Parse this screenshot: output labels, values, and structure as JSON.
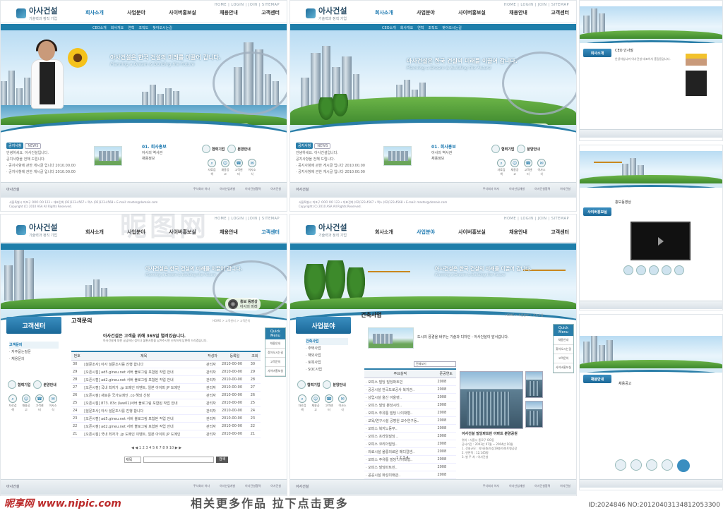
{
  "brand": {
    "name": "아사건설",
    "tagline": "기술력과 정직 기업"
  },
  "util_links": "HOME | LOGIN | JOIN | SITEMAP",
  "menu": [
    "회사소개",
    "사업분야",
    "사이버홍보실",
    "채용안내",
    "고객센터"
  ],
  "sublinks": [
    "CEO소개",
    "회사개요",
    "연혁",
    "조직도",
    "찾아오시는길"
  ],
  "slogan": "아사건설은 한국 건설의 미래를 이끌어 갑니다.",
  "slogan_en": "Planning a Dream & Building the Future",
  "promo": {
    "title": "홍보 동영상",
    "sub": "아사의 미래"
  },
  "news": {
    "tag": "공지사항",
    "tag2": "NEWS",
    "items": [
      "안녕하세요. 아사건설입니다.",
      "공지사항을 전해 드립니다.",
      "· 공지사항에 관한 게시글 입니다 2010.00.00",
      "· 공지사항에 관한 게시글 입니다 2010.00.00"
    ]
  },
  "pr": {
    "title": "01. 회사홍보",
    "line1": "아사의 역사관",
    "line2": "채용정보"
  },
  "circ": [
    "협력기업",
    "분양안내"
  ],
  "icons": [
    "자료검색",
    "채용공고",
    "고객센터",
    "이사소식"
  ],
  "footer_links": [
    "아사건설",
    "주식회사 아사",
    "아사산업개발",
    "아사건설협력",
    "아사건설"
  ],
  "address": "서울특별시 마포구 OOO OO 123 • 대표전화 (02)123-4567 • 팩스 (02)123-4568 • E-mail: master@domain.com",
  "copyright": "Copyright (C) 2010 ASA All Rights Reserved.",
  "customer": {
    "side_title": "고객센터",
    "side_menu": [
      "고객문의",
      "· 자주묻는질문",
      "· 채용문의"
    ],
    "page_title": "고객문의",
    "crumb": "HOME > 고객센터 > 고객문의",
    "intro": "아사건설은 고객을 위해 365일 열려있습니다.",
    "intro2": "아사건설에 대한 궁금하신 점이나 불편사항을 남겨주시면 신속하게 답변해 드리겠습니다.",
    "cols": [
      "번호",
      "제목",
      "작성자",
      "등록일",
      "조회"
    ],
    "rows": [
      [
        "30",
        "[설문조사] 아사 설문조사를 진행 합니다",
        "관리자",
        "2010-00-00",
        "30"
      ],
      [
        "29",
        "[오픈시점] ad5.gineu.net 서버 블로그링 포함된 작업 안내",
        "관리자",
        "2010-00-00",
        "29"
      ],
      [
        "28",
        "[오픈시점] ad2.gineu.net 서버 블로그링 포함된 작업 안내",
        "관리자",
        "2010-00-00",
        "28"
      ],
      [
        "27",
        "[오픈시점] 국내 최저가 .jp 도메인 이벤트, 일본 아이피 JP 도메인",
        "관리자",
        "2010-00-00",
        "27"
      ],
      [
        "26",
        "[오픈시점] 새로운 국가도메인 .co 해외 신청",
        "관리자",
        "2010-00-00",
        "26"
      ],
      [
        "25",
        "[오픈시점] 873. 83c.(law01)서버 블로그링 포함된 작업 안내",
        "관리자",
        "2010-00-00",
        "25"
      ],
      [
        "24",
        "[설문조사] 아사 설문조사를 진행 합니다",
        "관리자",
        "2010-00-00",
        "24"
      ],
      [
        "23",
        "[오픈시점] ad5.gineu.net 서버 블로그링 포함된 작업 안내",
        "관리자",
        "2010-00-00",
        "23"
      ],
      [
        "22",
        "[오픈시점] ad2.gineu.net 서버 블로그링 포함된 작업 안내",
        "관리자",
        "2010-00-00",
        "22"
      ],
      [
        "21",
        "[오픈시점] 국내 최저가 .jp 도메인 이벤트, 일본 아이피 JP 도메인",
        "관리자",
        "2010-00-00",
        "21"
      ]
    ],
    "pager": "◀ ◀  1 2 3 4 5 6 7 8 9 10  ▶ ▶",
    "search_sel": "제목",
    "search_btn": "검색"
  },
  "business": {
    "side_title": "사업분야",
    "side_menu": [
      "건축사업",
      "· 주택사업",
      "· 해외사업",
      "· 토목사업",
      "· SOC사업"
    ],
    "page_title": "건축사업",
    "crumb": "HOME > 사업분야 > 건축사업",
    "intro": "도시의 풍경을 바꾸는 기술과 디자인 - 아사건설이 앞서갑니다.",
    "cols": [
      "주요실적",
      "준공연도"
    ],
    "select": "전체보기",
    "rows": [
      [
        "· 오피스 빌딩 빌딩파트민",
        "2008"
      ],
      [
        "· 공공시설 한국도로공사 복지관..",
        "2008"
      ],
      [
        "· 상업시설 울산 아울렛..",
        "2008"
      ],
      [
        "· 오피스 빌딩 분당시티..",
        "2008"
      ],
      [
        "· 오피스 주유통 빌딩 나이대형..",
        "2008"
      ],
      [
        "· 교육/연구시설 공명원 교수연구동..",
        "2008"
      ],
      [
        "· 오피스 복지노동부..",
        "2008"
      ],
      [
        "· 오피스 프라임빌딩 ..",
        "2008"
      ],
      [
        "· 오피스 코리아빌딩..",
        "2008"
      ],
      [
        "· 의료시설 울릉의료원 메디칼센..",
        "2008"
      ],
      [
        "· 오피스 주유통 빌딩 나이대형..",
        "2008"
      ],
      [
        "· 오피스 빌딩파트민..",
        "2008"
      ],
      [
        "· 공공시설 화성미래관..",
        "2008"
      ]
    ],
    "photo_caption": "아사건설 빌딩파트민 아파트 분양공원",
    "details": [
      "위치 : 서울시 종로구 OO동",
      "공사기간 : 2003년 07월 ~ 2004년 10월",
      "1. 건설규모 : 지하3층/지상19층/아파트형공장",
      "2. 연면적 : 12,145평",
      "3. 발 주 처 : 아사건설"
    ],
    "pages": "1 2 3 4",
    "quick": {
      "head": "Quick Menu",
      "items": [
        "채용안내",
        "찾아오시는길",
        "고객문의",
        "사이버홍보실"
      ]
    }
  },
  "right_panels": {
    "ceo_title": "CEO 인사말",
    "ceo_text": "안녕하십니까 아사건설 대표이사 홍길동입니다.",
    "video_caption": "홍보동영상",
    "recruit_title": "채용공고"
  },
  "watermark": {
    "site": "昵享网 www.nipic.com",
    "promo": "相关更多作品   拉下点击更多",
    "id": "ID:2024846 NO:20120403134812053300"
  }
}
